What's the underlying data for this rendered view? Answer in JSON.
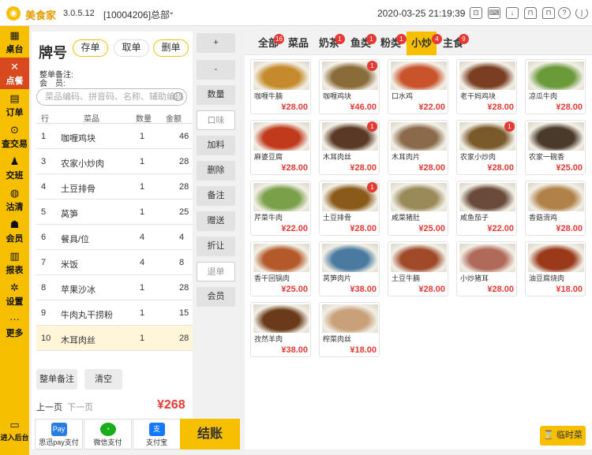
{
  "topbar": {
    "app_name": "美食家",
    "version": "3.0.5.12",
    "store": "[10004206]总部",
    "store_chevron": "⌄",
    "datetime": "2020-03-25 21:19:39",
    "icons": [
      "scan-icon",
      "keyboard-icon",
      "download-icon",
      "lock-open-icon",
      "lock-icon",
      "help-icon",
      "power-icon"
    ]
  },
  "sidebar": {
    "items": [
      {
        "label": "桌台",
        "icon": "table-icon"
      },
      {
        "label": "点餐",
        "icon": "fork-knife-icon",
        "active": true
      },
      {
        "label": "订单",
        "icon": "order-icon"
      },
      {
        "label": "查交易",
        "icon": "transaction-icon"
      },
      {
        "label": "交班",
        "icon": "handover-icon"
      },
      {
        "label": "沽清",
        "icon": "soldout-icon"
      },
      {
        "label": "会员",
        "icon": "members-icon"
      },
      {
        "label": "报表",
        "icon": "report-icon"
      },
      {
        "label": "设置",
        "icon": "settings-icon"
      },
      {
        "label": "更多",
        "icon": "more-icon"
      }
    ],
    "backend_label": "进入后台"
  },
  "order": {
    "title": "牌号",
    "store_btn": "存单",
    "fetch_btn": "取单",
    "clear_btn": "删单",
    "note_label": "整单备注:",
    "member_label": "会　员:",
    "search_placeholder": "菜品编码、拼音码、名称、辅助编码",
    "headers": [
      "行",
      "菜品",
      "数量",
      "金额"
    ],
    "rows": [
      {
        "no": "1",
        "name": "咖喱鸡块",
        "qty": "1",
        "amount": "46"
      },
      {
        "no": "3",
        "name": "农家小炒肉",
        "qty": "1",
        "amount": "28"
      },
      {
        "no": "4",
        "name": "土豆排骨",
        "qty": "1",
        "amount": "28"
      },
      {
        "no": "5",
        "name": "莴笋",
        "qty": "1",
        "amount": "25"
      },
      {
        "no": "6",
        "name": "餐具/位",
        "qty": "4",
        "amount": "4"
      },
      {
        "no": "7",
        "name": "米饭",
        "qty": "4",
        "amount": "8"
      },
      {
        "no": "8",
        "name": "苹果沙冰",
        "qty": "1",
        "amount": "28"
      },
      {
        "no": "9",
        "name": "牛肉丸干捞粉",
        "qty": "1",
        "amount": "15"
      },
      {
        "no": "10",
        "name": "木耳肉丝",
        "qty": "1",
        "amount": "28"
      }
    ],
    "note_btn": "整单备注",
    "empty_btn": "清空",
    "prev_page": "上一页",
    "next_page": "下一页",
    "total": "¥268"
  },
  "payments": {
    "sixun_icon": "Pay",
    "sixun": "思迅pay支付",
    "wechat": "微信支付",
    "alipay_icon": "支",
    "alipay": "支付宝",
    "checkout": "结账"
  },
  "ops": {
    "plus": "+",
    "minus": "-",
    "qty": "数量",
    "taste": "口味",
    "add": "加料",
    "delete": "删除",
    "remark": "备注",
    "gift": "赠送",
    "discount": "折让",
    "refund": "退单",
    "member": "会员"
  },
  "tabs": [
    {
      "label": "全部",
      "badge": "16"
    },
    {
      "label": "菜品",
      "badge": ""
    },
    {
      "label": "奶茶",
      "badge": "1"
    },
    {
      "label": "鱼类",
      "badge": "1"
    },
    {
      "label": "粉类",
      "badge": "1"
    },
    {
      "label": "小炒",
      "badge": "4",
      "active": true
    },
    {
      "label": "主食",
      "badge": "9"
    }
  ],
  "dishes": [
    {
      "name": "咖喱牛腩",
      "price": "¥28.00",
      "badge": "",
      "color": "#c58a2b"
    },
    {
      "name": "咖喱鸡块",
      "price": "¥46.00",
      "badge": "1",
      "color": "#8a6b3a"
    },
    {
      "name": "口水鸡",
      "price": "¥22.00",
      "badge": "",
      "color": "#c9542b"
    },
    {
      "name": "老干妈鸡块",
      "price": "¥28.00",
      "badge": "",
      "color": "#7a3e22"
    },
    {
      "name": "凉瓜牛肉",
      "price": "¥28.00",
      "badge": "",
      "color": "#6a9a3a"
    },
    {
      "name": "麻婆豆腐",
      "price": "¥28.00",
      "badge": "",
      "color": "#c23a1c"
    },
    {
      "name": "木耳肉丝",
      "price": "¥28.00",
      "badge": "1",
      "color": "#5a3a26"
    },
    {
      "name": "木耳肉片",
      "price": "¥28.00",
      "badge": "",
      "color": "#8a6a4a"
    },
    {
      "name": "农家小炒肉",
      "price": "¥28.00",
      "badge": "1",
      "color": "#7a5a2a"
    },
    {
      "name": "农家一碗香",
      "price": "¥25.00",
      "badge": "",
      "color": "#4a3a2a"
    },
    {
      "name": "芹菜牛肉",
      "price": "¥22.00",
      "badge": "",
      "color": "#7aa04a"
    },
    {
      "name": "土豆排骨",
      "price": "¥28.00",
      "badge": "1",
      "color": "#8a5a1a"
    },
    {
      "name": "咸菜猪肚",
      "price": "¥25.00",
      "badge": "",
      "color": "#9a8a5a"
    },
    {
      "name": "咸鱼茄子",
      "price": "¥22.00",
      "badge": "",
      "color": "#6a4a3a"
    },
    {
      "name": "香菇滑鸡",
      "price": "¥28.00",
      "badge": "",
      "color": "#b0824a"
    },
    {
      "name": "香干回锅肉",
      "price": "¥25.00",
      "badge": "",
      "color": "#b45a2a"
    },
    {
      "name": "莴笋肉片",
      "price": "¥38.00",
      "badge": "",
      "color": "#4a7aa0"
    },
    {
      "name": "土豆牛腩",
      "price": "¥28.00",
      "badge": "",
      "color": "#a04a2a"
    },
    {
      "name": "小炒猪耳",
      "price": "¥28.00",
      "badge": "",
      "color": "#b06a5a"
    },
    {
      "name": "油豆腐烧肉",
      "price": "¥18.00",
      "badge": "",
      "color": "#9a3a1a"
    },
    {
      "name": "孜然羊肉",
      "price": "¥38.00",
      "badge": "",
      "color": "#6a3a1a"
    },
    {
      "name": "榨菜肉丝",
      "price": "¥18.00",
      "badge": "",
      "color": "#c8a07a"
    }
  ],
  "temp_dish": "临时菜",
  "temp_dish_icon": "⌛"
}
